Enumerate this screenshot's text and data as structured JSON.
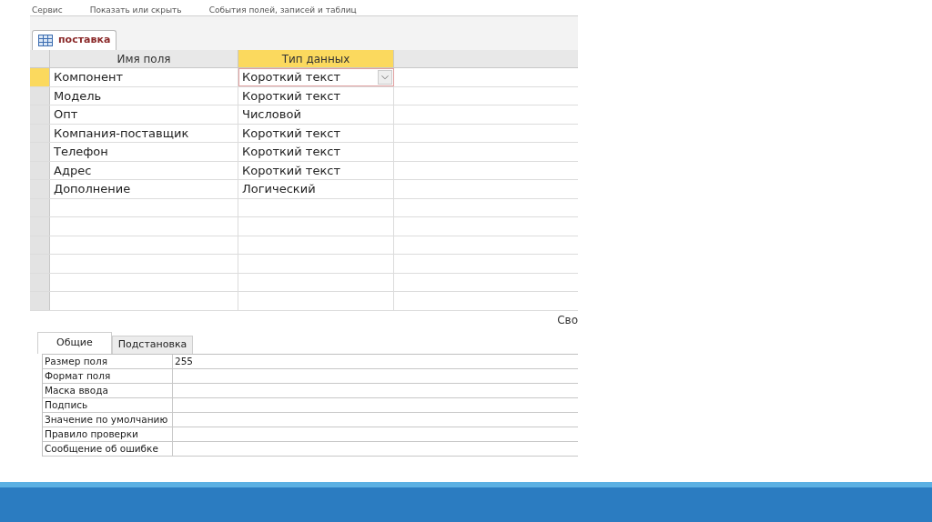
{
  "ribbon_groups": [
    "Сервис",
    "Показать или скрыть",
    "События полей, записей и таблиц"
  ],
  "document_tab": {
    "title": "поставка"
  },
  "design_grid": {
    "columns": [
      {
        "label": "Имя поля",
        "selected": false
      },
      {
        "label": "Тип данных",
        "selected": true
      }
    ],
    "rows": [
      {
        "field_name": "Компонент",
        "data_type": "Короткий текст",
        "selected": true
      },
      {
        "field_name": "Модель",
        "data_type": "Короткий текст",
        "selected": false
      },
      {
        "field_name": "Опт",
        "data_type": "Числовой",
        "selected": false
      },
      {
        "field_name": "Компания-поставщик",
        "data_type": "Короткий текст",
        "selected": false
      },
      {
        "field_name": "Телефон",
        "data_type": "Короткий текст",
        "selected": false
      },
      {
        "field_name": "Адрес",
        "data_type": "Короткий текст",
        "selected": false
      },
      {
        "field_name": "Дополнение",
        "data_type": "Логический",
        "selected": false
      }
    ],
    "empty_rows": [
      {
        "selected": false
      },
      {
        "selected": false
      },
      {
        "selected": false
      },
      {
        "selected": false
      },
      {
        "selected": false
      },
      {
        "selected": false
      }
    ]
  },
  "properties_label": "Сво",
  "property_tabs": [
    {
      "label": "Общие",
      "selected": true
    },
    {
      "label": "Подстановка",
      "selected": false
    }
  ],
  "properties": [
    {
      "label": "Размер поля",
      "value": "255"
    },
    {
      "label": "Формат поля"
    },
    {
      "label": "Маска ввода"
    },
    {
      "label": "Подпись"
    },
    {
      "label": "Значение по умолчанию"
    },
    {
      "label": "Правило проверки"
    },
    {
      "label": "Сообщение об ошибке"
    }
  ]
}
